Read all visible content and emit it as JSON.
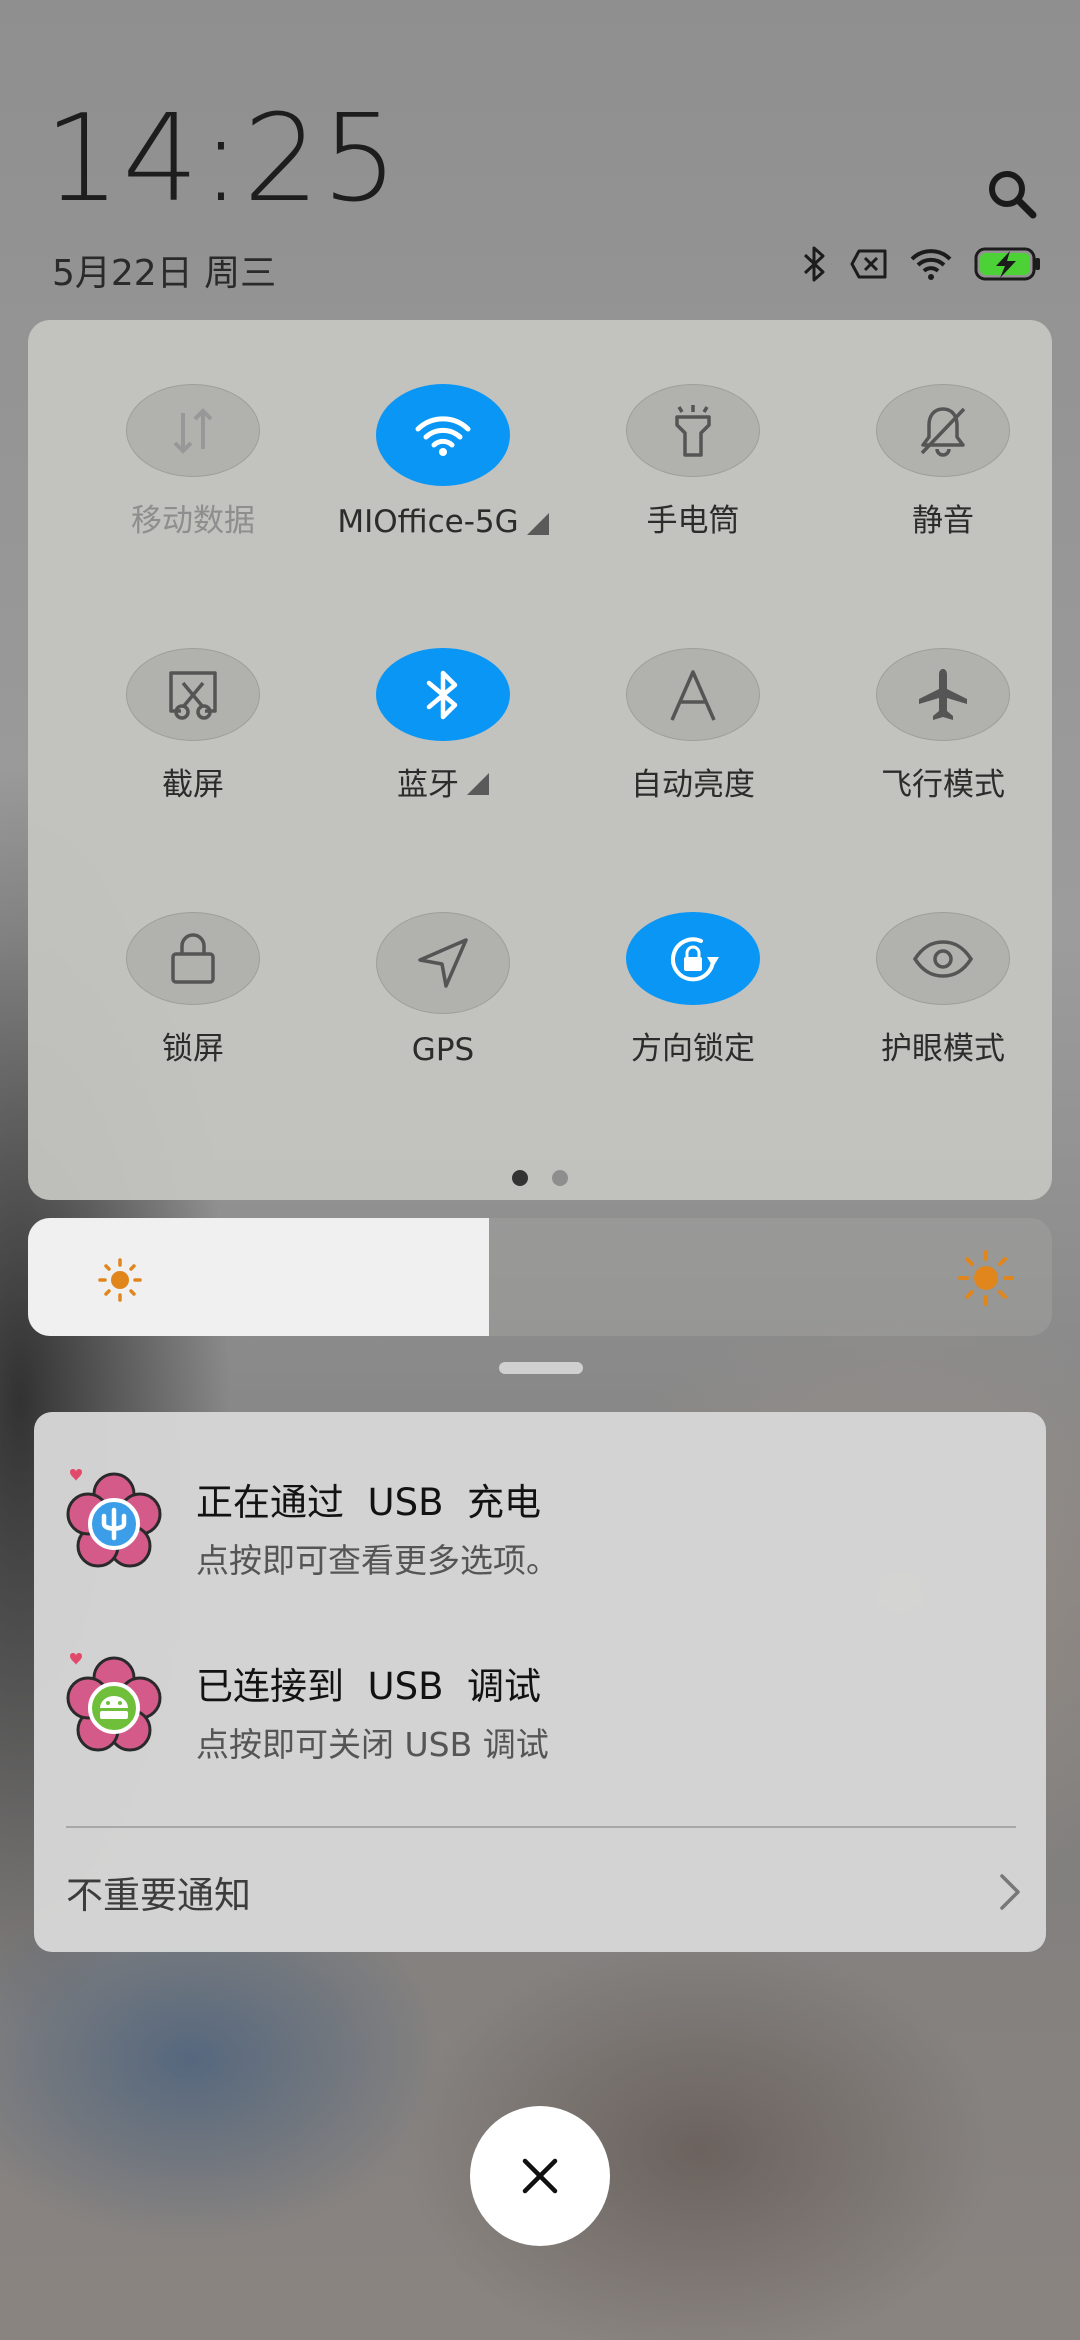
{
  "header": {
    "time": "14:25",
    "date": "5月22日 周三"
  },
  "status_bar": {
    "icons": [
      "bluetooth-icon",
      "no-sim-icon",
      "wifi-icon",
      "battery-charging-icon"
    ],
    "battery_color": "#4cd137"
  },
  "quick_settings": {
    "accent_color": "#0a96f5",
    "page_indicator": {
      "current": 1,
      "total": 2
    },
    "tiles": [
      {
        "label": "移动数据",
        "icon": "mobile-data-icon",
        "active": false,
        "disabled": true,
        "has_arrow": false
      },
      {
        "label": "MIOffice-5G",
        "icon": "wifi-icon",
        "active": true,
        "disabled": false,
        "has_arrow": true
      },
      {
        "label": "手电筒",
        "icon": "flashlight-icon",
        "active": false,
        "disabled": false,
        "has_arrow": false
      },
      {
        "label": "静音",
        "icon": "bell-off-icon",
        "active": false,
        "disabled": false,
        "has_arrow": false
      },
      {
        "label": "截屏",
        "icon": "screenshot-icon",
        "active": false,
        "disabled": false,
        "has_arrow": false
      },
      {
        "label": "蓝牙",
        "icon": "bluetooth-icon",
        "active": true,
        "disabled": false,
        "has_arrow": true
      },
      {
        "label": "自动亮度",
        "icon": "auto-brightness-icon",
        "active": false,
        "disabled": false,
        "has_arrow": false
      },
      {
        "label": "飞行模式",
        "icon": "airplane-icon",
        "active": false,
        "disabled": false,
        "has_arrow": false
      },
      {
        "label": "锁屏",
        "icon": "lock-icon",
        "active": false,
        "disabled": false,
        "has_arrow": false
      },
      {
        "label": "GPS",
        "icon": "gps-icon",
        "active": false,
        "disabled": false,
        "has_arrow": false
      },
      {
        "label": "方向锁定",
        "icon": "rotation-lock-icon",
        "active": true,
        "disabled": false,
        "has_arrow": false
      },
      {
        "label": "护眼模式",
        "icon": "eye-icon",
        "active": false,
        "disabled": false,
        "has_arrow": false
      }
    ]
  },
  "brightness": {
    "level": 0.45,
    "sun_color": "#e0861d"
  },
  "notifications": [
    {
      "title": "正在通过  USB  充电",
      "body": "点按即可查看更多选项。",
      "icon": "usb-flower-icon"
    },
    {
      "title": "已连接到  USB  调试",
      "body": "点按即可关闭 USB 调试",
      "icon": "android-flower-icon"
    }
  ],
  "unimportant_notifications_label": "不重要通知"
}
